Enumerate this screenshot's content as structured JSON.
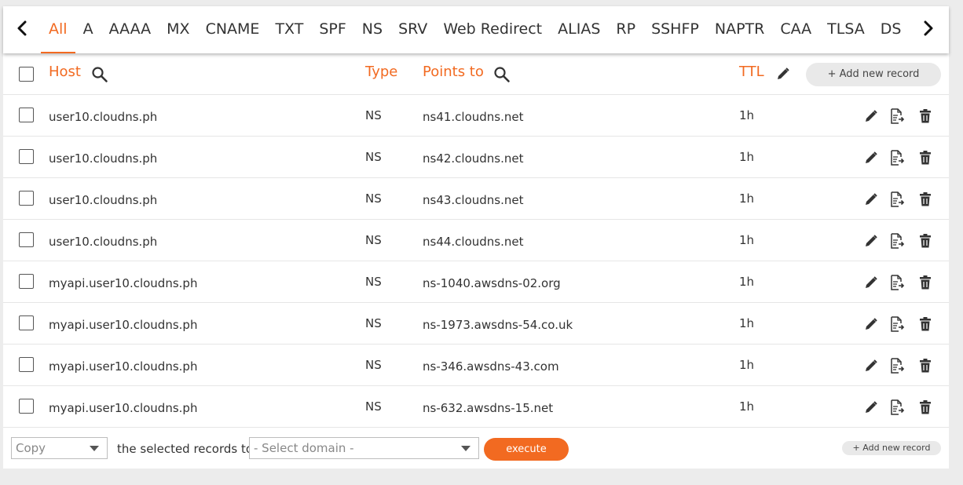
{
  "tabs": [
    "All",
    "A",
    "AAAA",
    "MX",
    "CNAME",
    "TXT",
    "SPF",
    "NS",
    "SRV",
    "Web Redirect",
    "ALIAS",
    "RP",
    "SSHFP",
    "NAPTR",
    "CAA",
    "TLSA",
    "DS"
  ],
  "active_tab": "All",
  "columns": {
    "host": "Host",
    "type": "Type",
    "points_to": "Points to",
    "ttl": "TTL"
  },
  "add_new_record_label": "+ Add new record",
  "records": [
    {
      "host": "user10.cloudns.ph",
      "type": "NS",
      "points_to": "ns41.cloudns.net",
      "ttl": "1h"
    },
    {
      "host": "user10.cloudns.ph",
      "type": "NS",
      "points_to": "ns42.cloudns.net",
      "ttl": "1h"
    },
    {
      "host": "user10.cloudns.ph",
      "type": "NS",
      "points_to": "ns43.cloudns.net",
      "ttl": "1h"
    },
    {
      "host": "user10.cloudns.ph",
      "type": "NS",
      "points_to": "ns44.cloudns.net",
      "ttl": "1h"
    },
    {
      "host": "myapi.user10.cloudns.ph",
      "type": "NS",
      "points_to": "ns-1040.awsdns-02.org",
      "ttl": "1h"
    },
    {
      "host": "myapi.user10.cloudns.ph",
      "type": "NS",
      "points_to": "ns-1973.awsdns-54.co.uk",
      "ttl": "1h"
    },
    {
      "host": "myapi.user10.cloudns.ph",
      "type": "NS",
      "points_to": "ns-346.awsdns-43.com",
      "ttl": "1h"
    },
    {
      "host": "myapi.user10.cloudns.ph",
      "type": "NS",
      "points_to": "ns-632.awsdns-15.net",
      "ttl": "1h"
    }
  ],
  "footer": {
    "action_select": "Copy",
    "middle_text": "the selected records to",
    "domain_select": "- Select domain -",
    "execute_label": "execute",
    "add_new_record_label": "+ Add new record"
  },
  "colors": {
    "accent": "#f26a21",
    "icon": "#333333"
  },
  "icons": {
    "prev": "chevron-left-icon",
    "next": "chevron-right-icon",
    "search": "search-icon",
    "edit": "pencil-icon",
    "export": "file-export-icon",
    "delete": "trash-icon"
  }
}
